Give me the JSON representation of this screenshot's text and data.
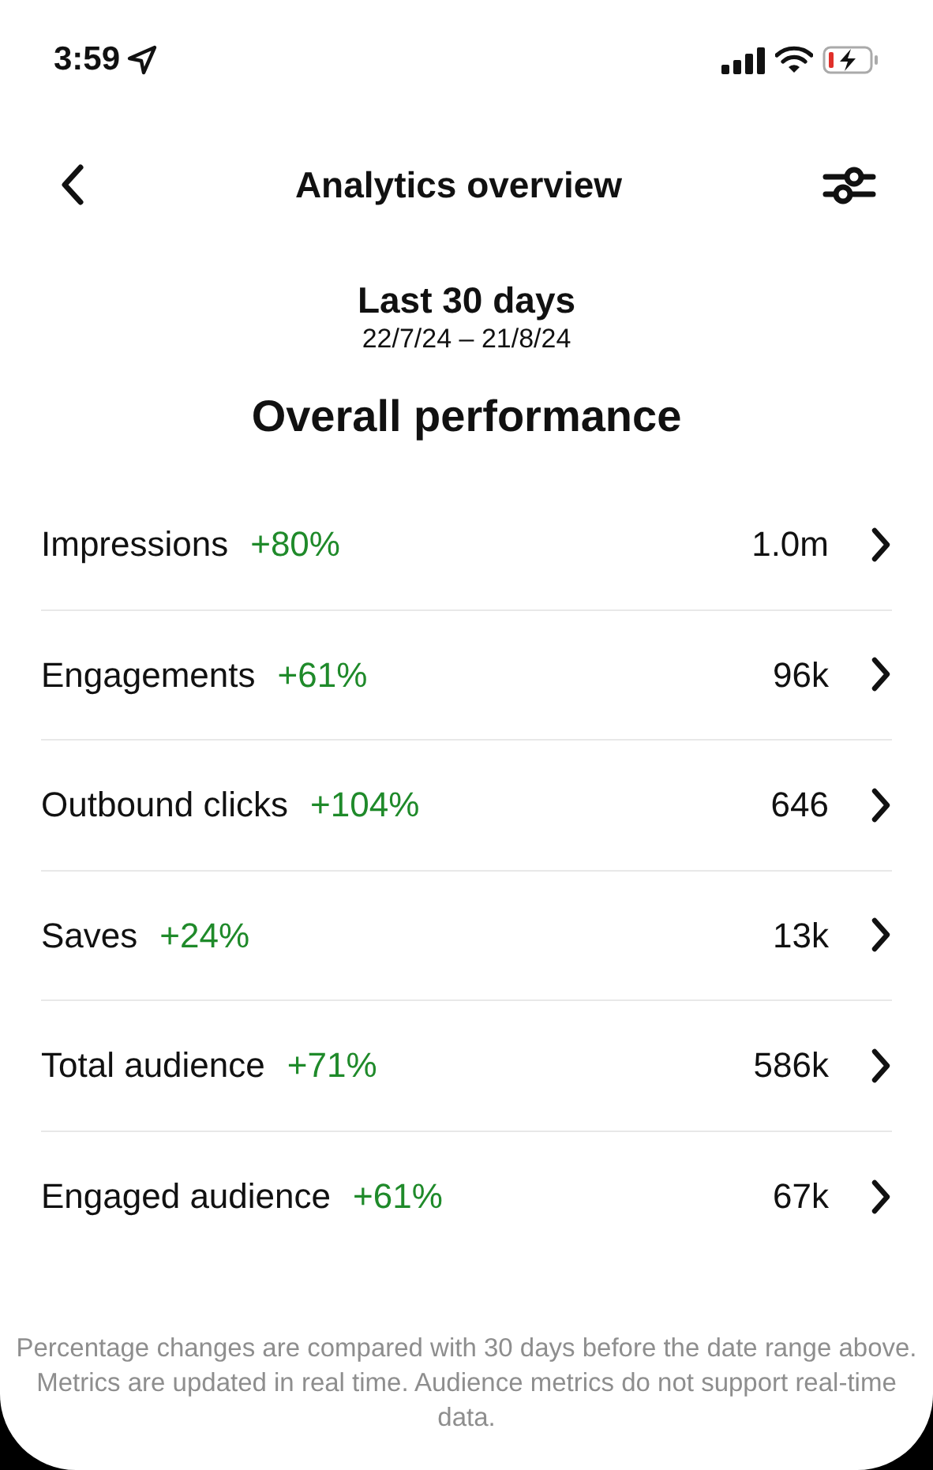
{
  "status_bar": {
    "time": "3:59"
  },
  "header": {
    "title": "Analytics overview"
  },
  "period": {
    "label": "Last 30 days",
    "range": "22/7/24 – 21/8/24"
  },
  "section_title": "Overall performance",
  "metrics": [
    {
      "name": "Impressions",
      "change": "+80%",
      "value": "1.0m"
    },
    {
      "name": "Engagements",
      "change": "+61%",
      "value": "96k"
    },
    {
      "name": "Outbound clicks",
      "change": "+104%",
      "value": "646"
    },
    {
      "name": "Saves",
      "change": "+24%",
      "value": "13k"
    },
    {
      "name": "Total audience",
      "change": "+71%",
      "value": "586k"
    },
    {
      "name": "Engaged audience",
      "change": "+61%",
      "value": "67k"
    }
  ],
  "footnote": "Percentage changes are compared with 30 days before the date range above. Metrics are updated in real time. Audience metrics do not support real-time data."
}
